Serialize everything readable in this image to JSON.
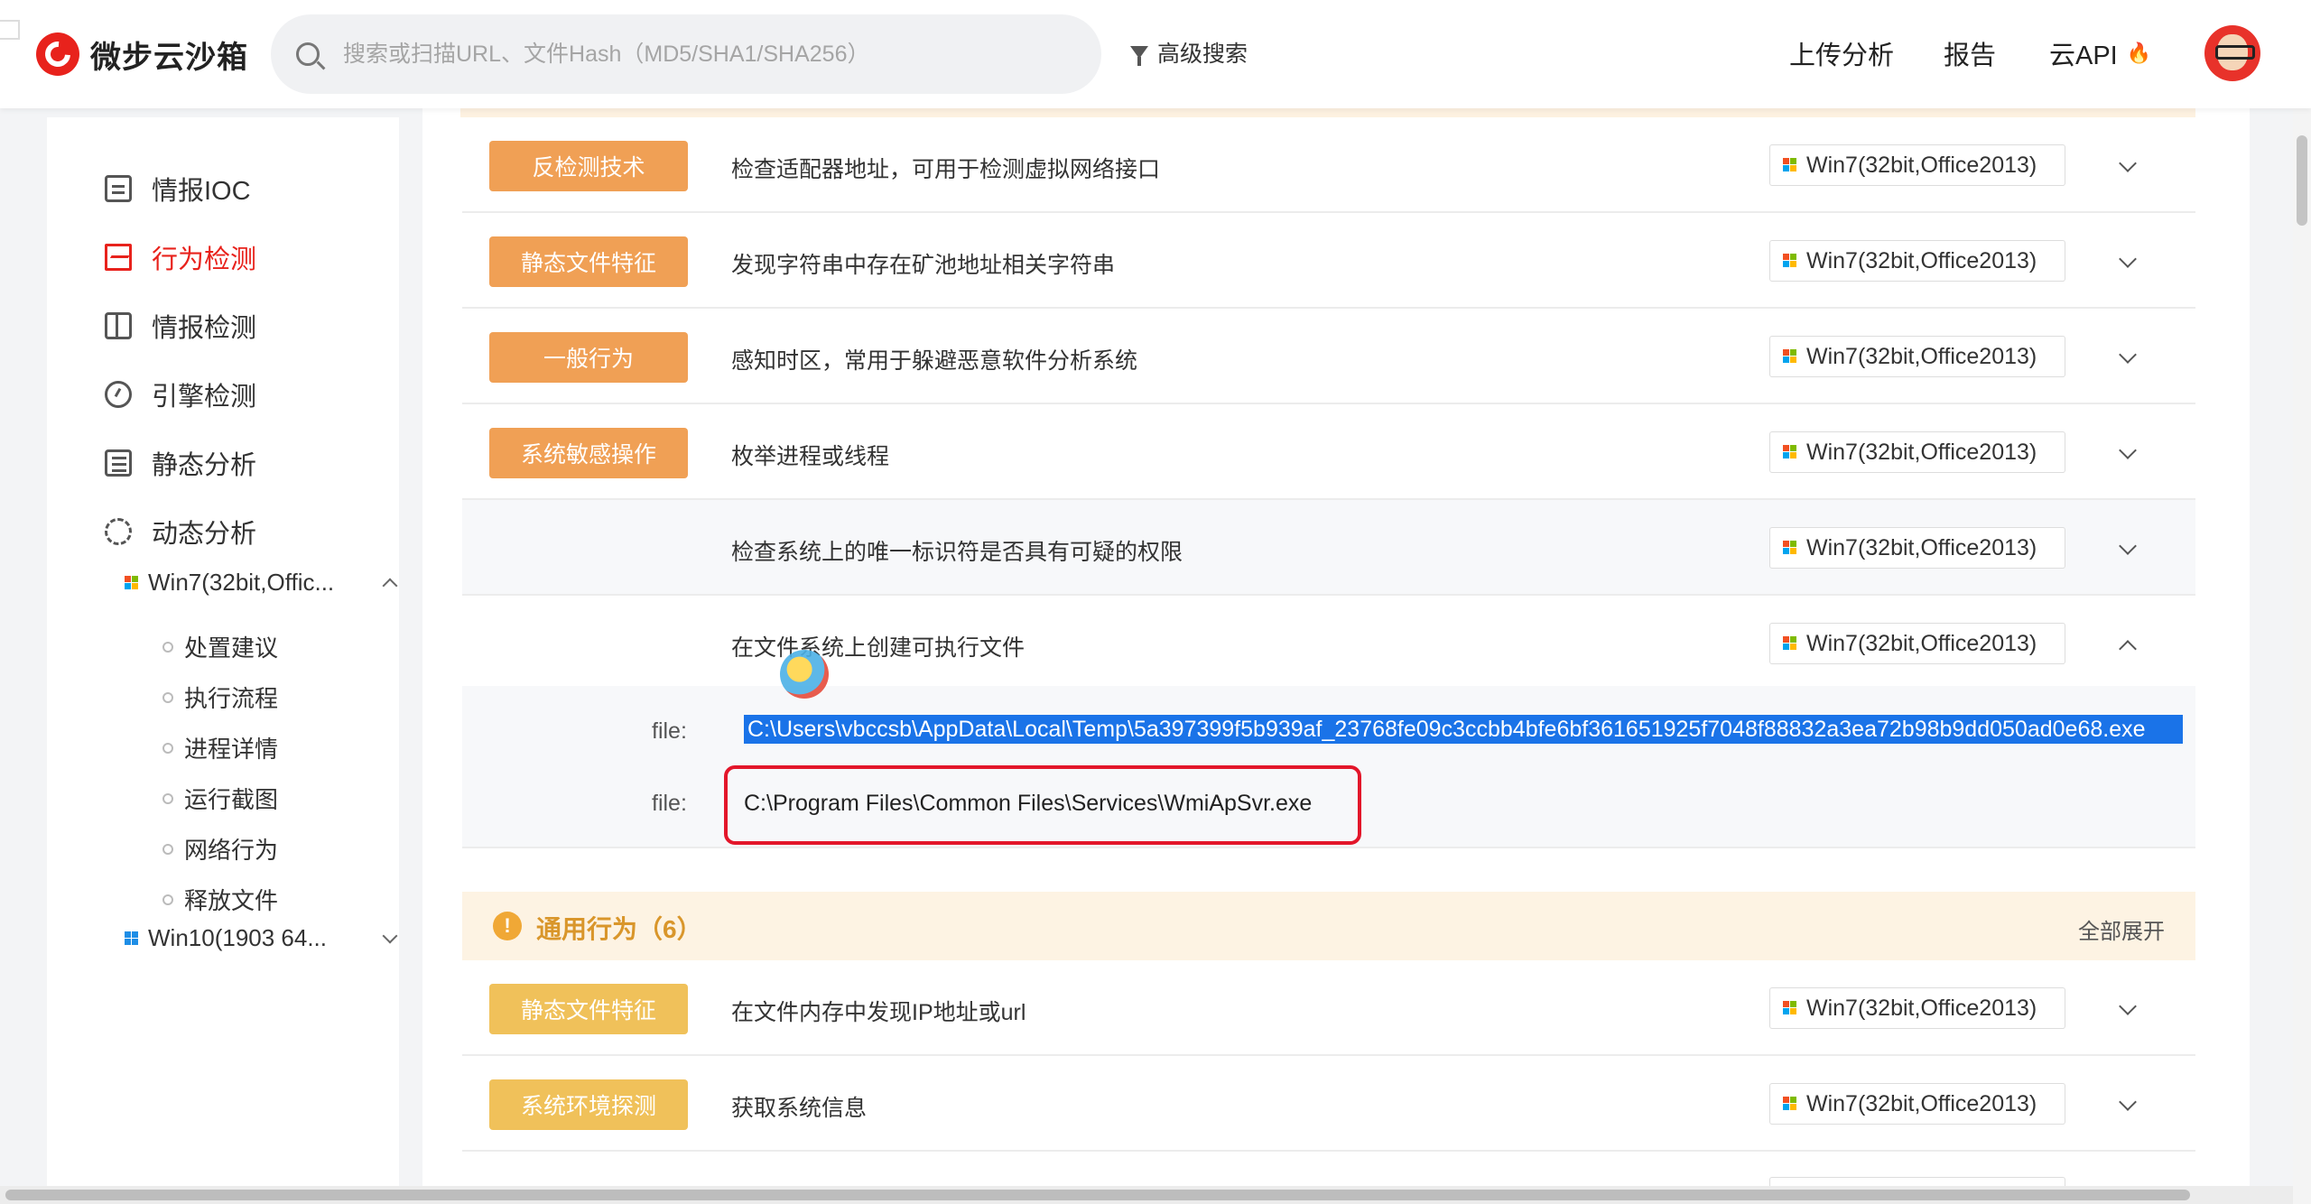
{
  "header": {
    "logo_text": "微步云沙箱",
    "search_placeholder": "搜索或扫描URL、文件Hash（MD5/SHA1/SHA256）",
    "advanced_search": "高级搜索",
    "nav": {
      "upload": "上传分析",
      "report": "报告",
      "api": "云API"
    }
  },
  "sidebar": {
    "items": [
      {
        "label": "情报IOC"
      },
      {
        "label": "行为检测"
      },
      {
        "label": "情报检测"
      },
      {
        "label": "引擎检测"
      },
      {
        "label": "静态分析"
      },
      {
        "label": "动态分析"
      }
    ],
    "env_win7": "Win7(32bit,Offic...",
    "sub_items": [
      "处置建议",
      "执行流程",
      "进程详情",
      "运行截图",
      "网络行为",
      "释放文件"
    ],
    "env_win10": "Win10(1903 64..."
  },
  "rows": [
    {
      "badge": "反检测技术",
      "desc": "检查适配器地址，可用于检测虚拟网络接口",
      "env": "Win7(32bit,Office2013)"
    },
    {
      "badge": "静态文件特征",
      "desc": "发现字符串中存在矿池地址相关字符串",
      "env": "Win7(32bit,Office2013)"
    },
    {
      "badge": "一般行为",
      "desc": "感知时区，常用于躲避恶意软件分析系统",
      "env": "Win7(32bit,Office2013)"
    },
    {
      "badge": "系统敏感操作",
      "desc": "枚举进程或线程",
      "env": "Win7(32bit,Office2013)"
    },
    {
      "badge": "",
      "desc": "检查系统上的唯一标识符是否具有可疑的权限",
      "env": "Win7(32bit,Office2013)"
    },
    {
      "badge": "",
      "desc": "在文件系统上创建可执行文件",
      "env": "Win7(32bit,Office2013)"
    }
  ],
  "detail": {
    "file_label": "file:",
    "file1": "C:\\Users\\vbccsb\\AppData\\Local\\Temp\\5a397399f5b939af_23768fe09c3ccbb4bfe6bf361651925f7048f88832a3ea72b98b9dd050ad0e68.exe",
    "file2": "C:\\Program Files\\Common Files\\Services\\WmiApSvr.exe"
  },
  "general": {
    "title": "通用行为（6）",
    "expand_all": "全部展开",
    "rows": [
      {
        "badge": "静态文件特征",
        "desc": "在文件内存中发现IP地址或url",
        "env": "Win7(32bit,Office2013)"
      },
      {
        "badge": "系统环境探测",
        "desc": "获取系统信息",
        "env": "Win7(32bit,Office2013)"
      }
    ]
  },
  "colors": {
    "brand": "#e8221c",
    "badge_orange": "#f0a055",
    "badge_yellow": "#f0c15a",
    "highlight": "#1a73e8",
    "annotation": "#e3162a"
  }
}
